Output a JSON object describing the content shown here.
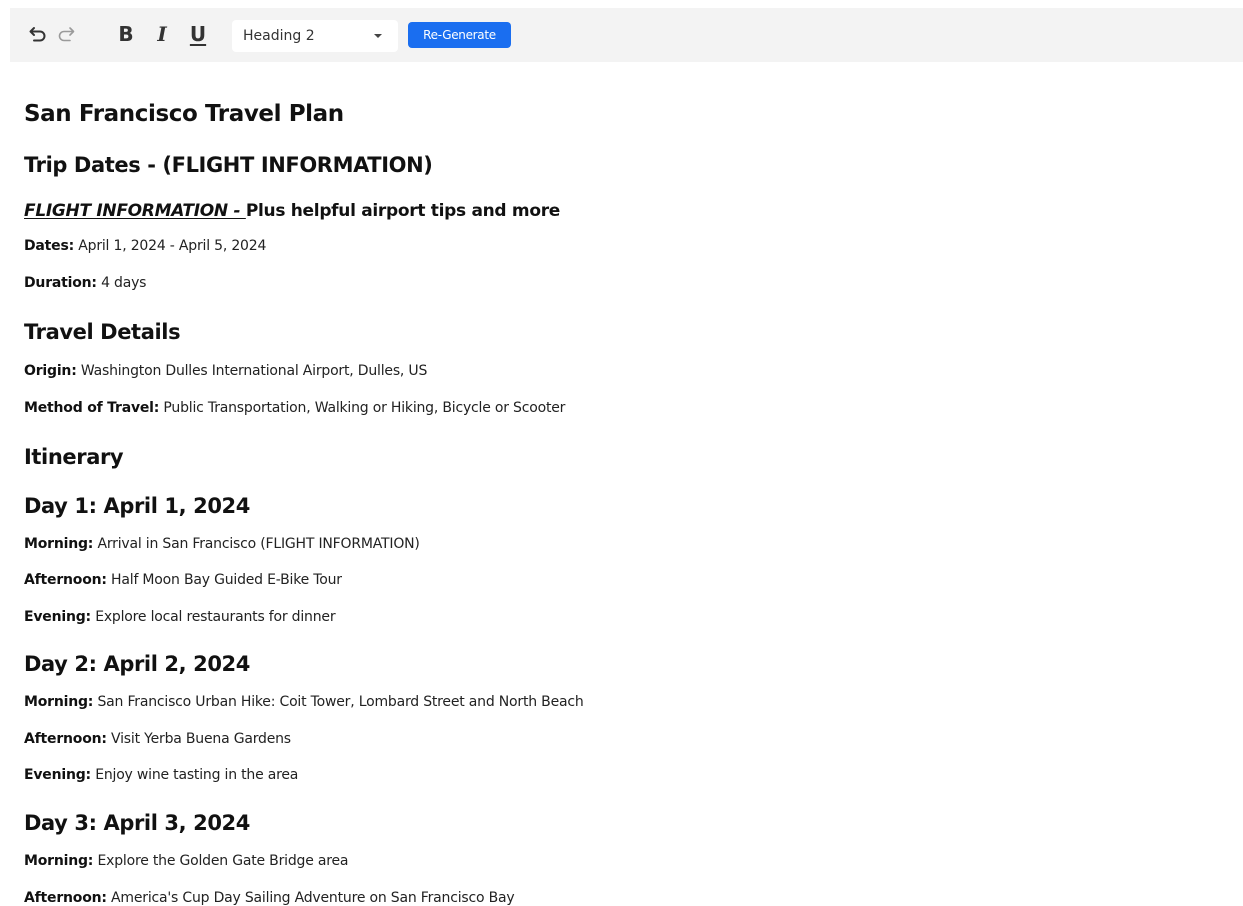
{
  "toolbar": {
    "undo_icon": "undo-icon",
    "redo_icon": "redo-icon",
    "bold_label": "B",
    "italic_label": "I",
    "underline_label": "U",
    "block_format": "Heading 2",
    "regenerate_label": "Re-Generate",
    "accent_color": "#1a6ef0"
  },
  "doc": {
    "title": "San Francisco Travel Plan",
    "trip_dates_heading": "Trip Dates - (FLIGHT INFORMATION)",
    "flight_link": "FLIGHT INFORMATION - ",
    "flight_rest": "Plus helpful airport tips and more",
    "dates": {
      "label": "Dates:",
      "value": " April 1, 2024 - April 5, 2024"
    },
    "duration": {
      "label": "Duration:",
      "value": " 4 days"
    },
    "travel_details_heading": "Travel Details",
    "origin": {
      "label": "Origin:",
      "value": " Washington Dulles International Airport, Dulles, US"
    },
    "method": {
      "label": "Method of Travel:",
      "value": " Public Transportation, Walking or Hiking, Bicycle or Scooter"
    },
    "itinerary_heading": "Itinerary",
    "days": [
      {
        "heading": "Day 1: April 1, 2024",
        "morning": {
          "label": "Morning:",
          "value": " Arrival in San Francisco (FLIGHT INFORMATION)"
        },
        "afternoon": {
          "label": "Afternoon:",
          "value": " Half Moon Bay Guided E-Bike Tour"
        },
        "evening": {
          "label": "Evening:",
          "value": " Explore local restaurants for dinner"
        }
      },
      {
        "heading": "Day 2: April 2, 2024",
        "morning": {
          "label": "Morning:",
          "value": " San Francisco Urban Hike: Coit Tower, Lombard Street and North Beach"
        },
        "afternoon": {
          "label": "Afternoon:",
          "value": " Visit Yerba Buena Gardens"
        },
        "evening": {
          "label": "Evening:",
          "value": " Enjoy wine tasting in the area"
        }
      },
      {
        "heading": "Day 3: April 3, 2024",
        "morning": {
          "label": "Morning:",
          "value": " Explore the Golden Gate Bridge area"
        },
        "afternoon": {
          "label": "Afternoon:",
          "value": " America's Cup Day Sailing Adventure on San Francisco Bay"
        }
      }
    ]
  }
}
